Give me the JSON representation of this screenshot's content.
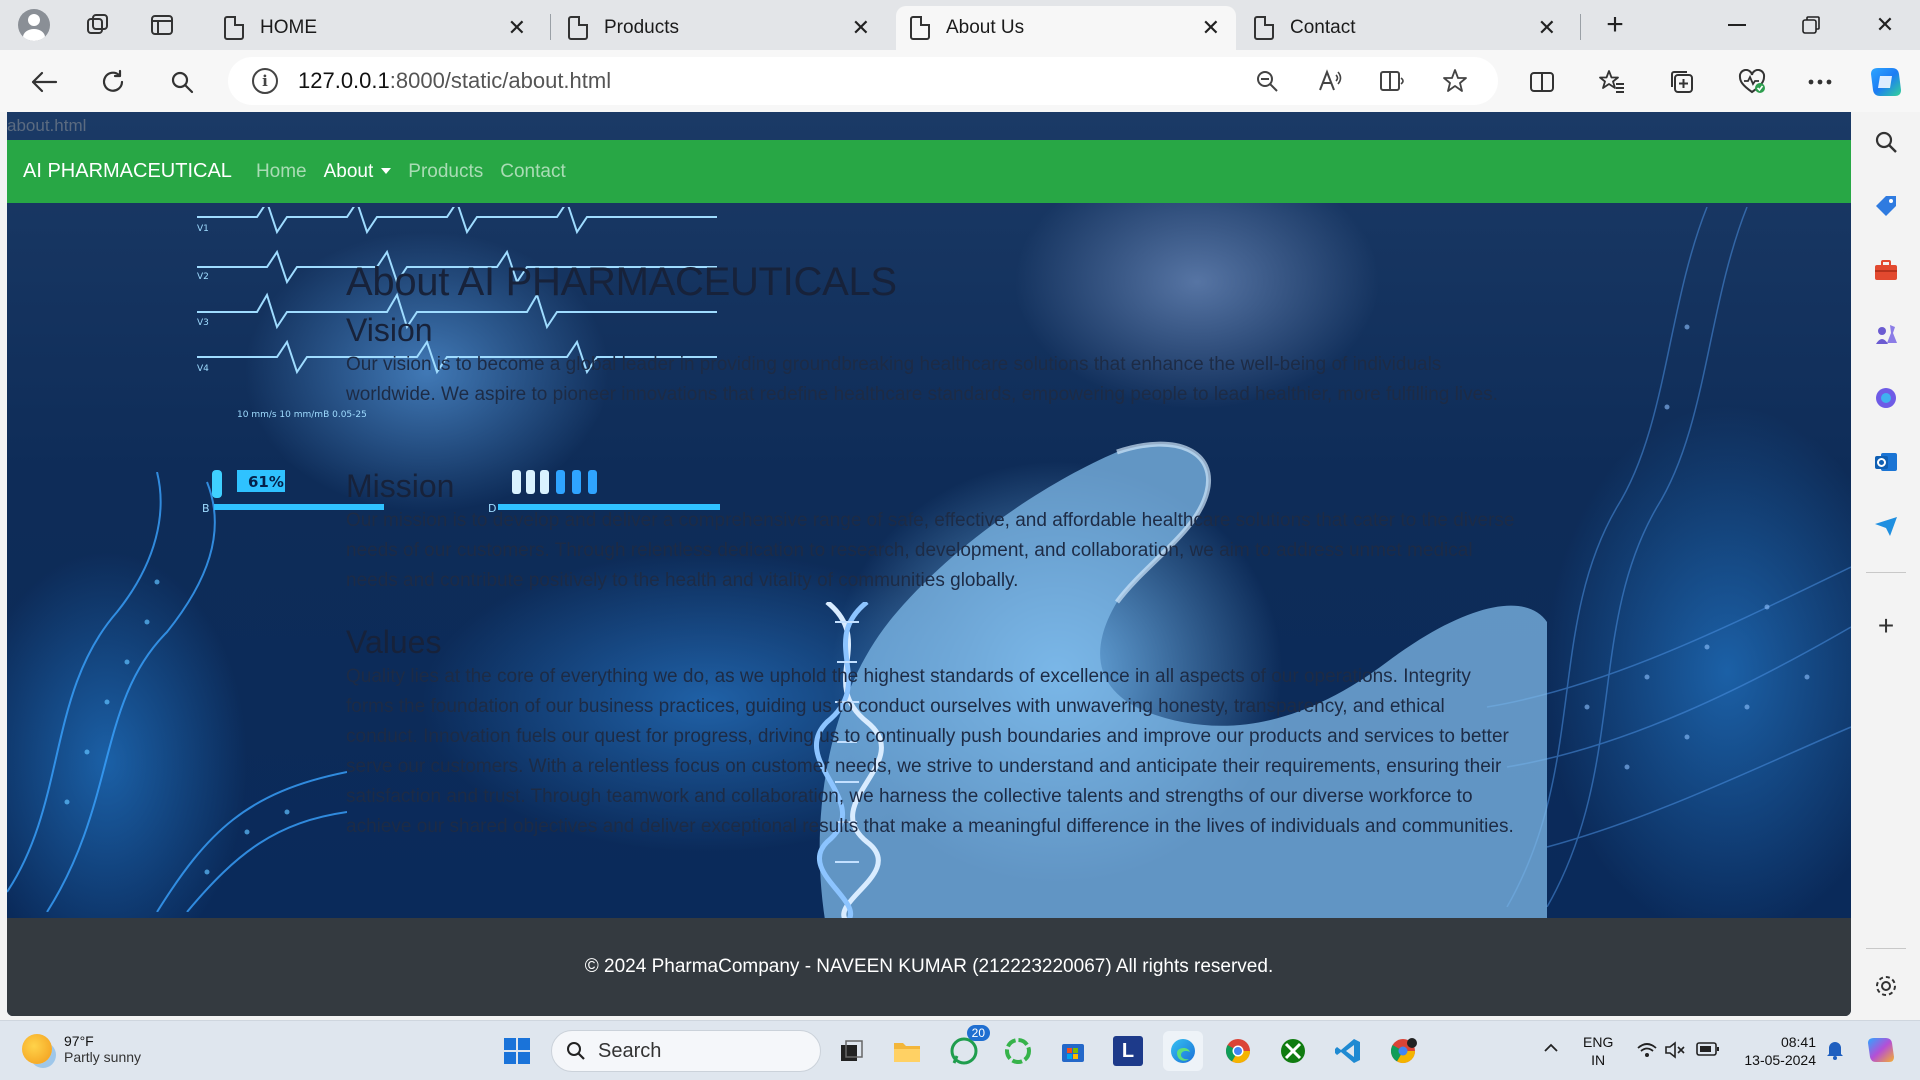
{
  "browser": {
    "tabs": [
      {
        "title": "HOME",
        "active": false
      },
      {
        "title": "Products",
        "active": false
      },
      {
        "title": "About Us",
        "active": true
      },
      {
        "title": "Contact",
        "active": false
      }
    ],
    "url_host": "127.0.0.1",
    "url_rest": ":8000/static/about.html",
    "status_text": "about.html"
  },
  "site": {
    "brand": "AI PHARMACEUTICAL",
    "nav": {
      "home": "Home",
      "about": "About",
      "products": "Products",
      "contact": "Contact"
    },
    "page_title": "About AI PHARMACEUTICALS",
    "vision_heading": "Vision",
    "vision_text": "Our vision is to become a global leader in providing groundbreaking healthcare solutions that enhance the well-being of individuals worldwide. We aspire to pioneer innovations that redefine healthcare standards, empowering people to lead healthier, more fulfilling lives.",
    "mission_heading": "Mission",
    "mission_text": "Our mission is to develop and deliver a comprehensive range of safe, effective, and affordable healthcare solutions that cater to the diverse needs of our customers. Through relentless dedication to research, development, and collaboration, we aim to address unmet medical needs and contribute positively to the health and vitality of communities globally.",
    "values_heading": "Values",
    "values_text": "Quality lies at the core of everything we do, as we uphold the highest standards of excellence in all aspects of our operations. Integrity forms the foundation of our business practices, guiding us to conduct ourselves with unwavering honesty, transparency, and ethical conduct. Innovation fuels our quest for progress, driving us to continually push boundaries and improve our products and services to better serve our customers. With a relentless focus on customer needs, we strive to understand and anticipate their requirements, ensuring their satisfaction and trust. Through teamwork and collaboration, we harness the collective talents and strengths of our diverse workforce to achieve our shared objectives and deliver exceptional results that make a meaningful difference in the lives of individuals and communities.",
    "footer": "© 2024 PharmaCompany - NAVEEN KUMAR (212223220067) All rights reserved."
  },
  "graphic_text": {
    "percent": "61%",
    "label_b": "B",
    "label_d": "D",
    "ecg_labels": [
      "V1",
      "V2",
      "V3",
      "V4"
    ],
    "ecg_scale": "10 mm/s    10 mm/mB    0.05-25"
  },
  "taskbar": {
    "weather_temp": "97°F",
    "weather_cond": "Partly sunny",
    "search_placeholder": "Search",
    "whatsapp_badge": "20",
    "lang_line1": "ENG",
    "lang_line2": "IN",
    "time": "08:41",
    "date": "13-05-2024"
  },
  "colors": {
    "navbar": "#28a745",
    "footer": "#343a40",
    "accent": "#1a73d9"
  },
  "icons": [
    "avatar-icon",
    "workspaces-icon",
    "tab-actions-icon",
    "back-icon",
    "refresh-icon",
    "search-icon",
    "info-icon",
    "zoom-out-icon",
    "read-aloud-icon",
    "immersive-reader-icon",
    "favorite-star-icon",
    "split-screen-icon",
    "favorites-icon",
    "collections-icon",
    "browser-essentials-icon",
    "more-icon",
    "copilot-icon",
    "settings-icon"
  ]
}
